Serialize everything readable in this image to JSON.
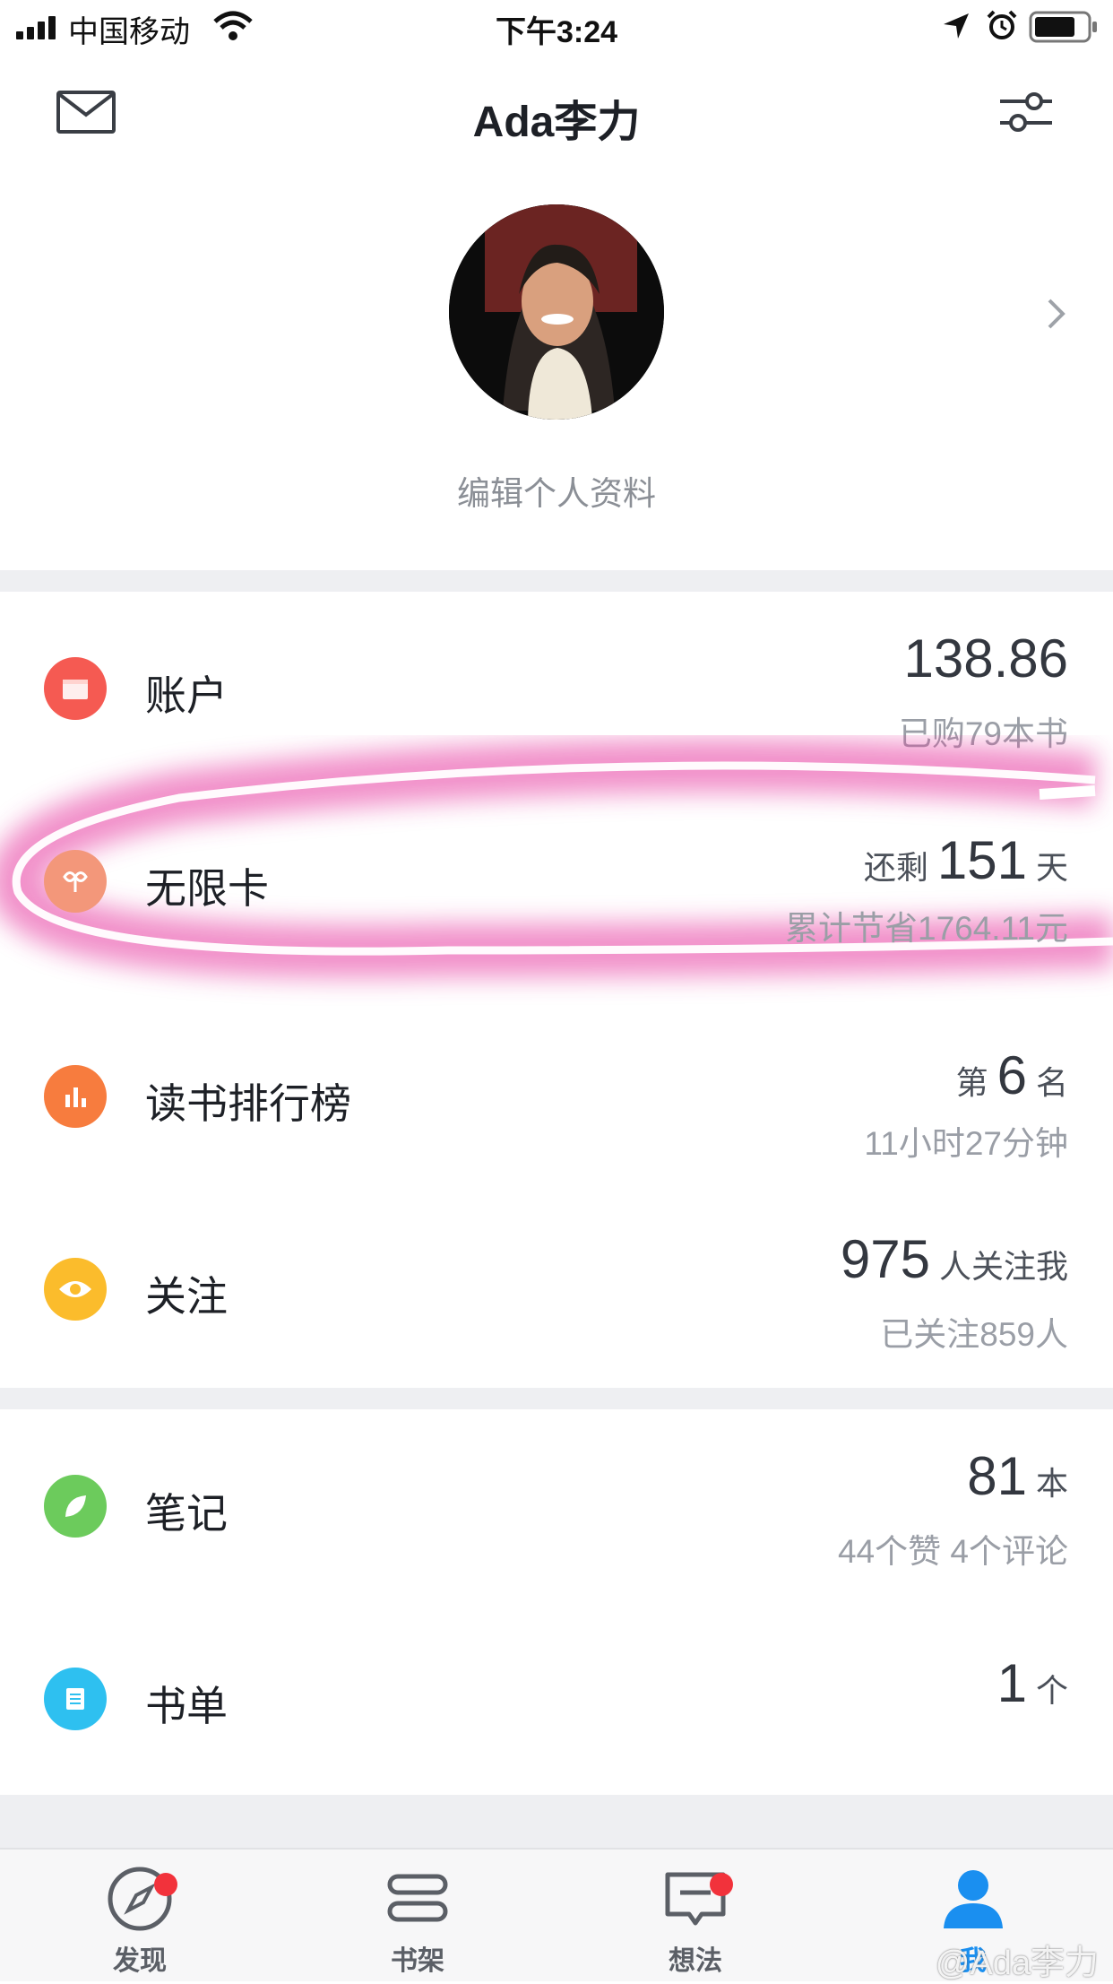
{
  "status_bar": {
    "carrier": "中国移动",
    "time": "下午3:24"
  },
  "header": {
    "title": "Ada李力",
    "mail_icon": "mail-icon",
    "filter_icon": "filter-icon"
  },
  "profile": {
    "edit_label": "编辑个人资料"
  },
  "rows": {
    "account": {
      "label": "账户",
      "value": "138.86",
      "sub": "已购79本书",
      "color": "#f55a52"
    },
    "unlimited": {
      "label": "无限卡",
      "prefix": "还剩",
      "value": "151",
      "suffix": "天",
      "sub": "累计节省1764.11元",
      "color": "#f3977a"
    },
    "ranking": {
      "label": "读书排行榜",
      "prefix": "第",
      "value": "6",
      "suffix": "名",
      "sub": "11小时27分钟",
      "color": "#f77c3e"
    },
    "follow": {
      "label": "关注",
      "value": "975",
      "suffix": "人关注我",
      "sub": "已关注859人",
      "color": "#fbbc2c"
    },
    "notes": {
      "label": "笔记",
      "value": "81",
      "suffix": "本",
      "sub": "44个赞 4个评论",
      "color": "#6ccb5c"
    },
    "booklist": {
      "label": "书单",
      "value": "1",
      "suffix": "个",
      "color": "#2ec0f0"
    }
  },
  "tabs": [
    {
      "label": "发现",
      "icon": "compass-icon",
      "badge": true
    },
    {
      "label": "书架",
      "icon": "bookshelf-icon",
      "badge": false
    },
    {
      "label": "想法",
      "icon": "message-icon",
      "badge": true
    },
    {
      "label": "我",
      "icon": "user-icon",
      "badge": false,
      "active": true
    }
  ],
  "watermark": "@Ada李力",
  "colors": {
    "accent": "#1a8ff0",
    "highlight": "#e6379f"
  }
}
